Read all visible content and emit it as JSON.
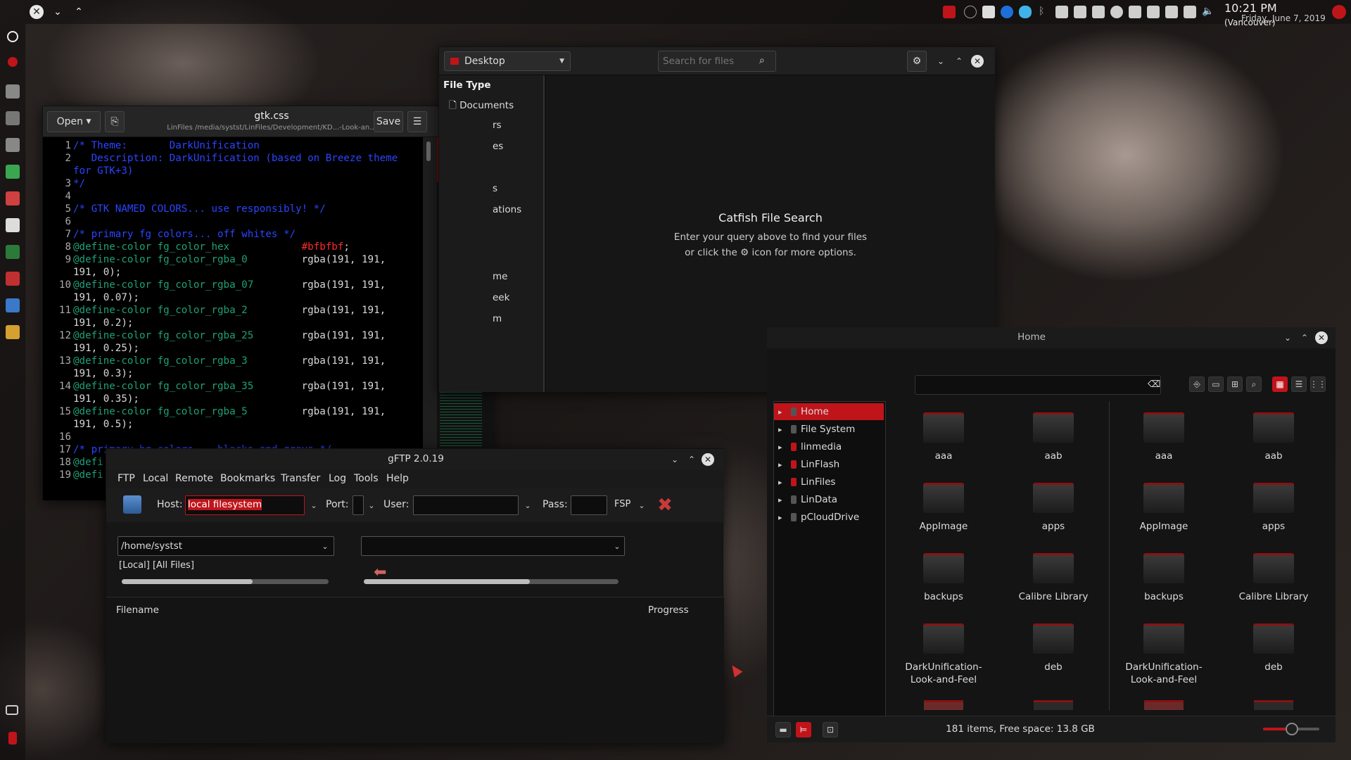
{
  "topbar": {
    "clock_time": "10:21 PM",
    "clock_tz": "(Vancouver)",
    "clock_date": "Friday, June 7, 2019"
  },
  "gedit": {
    "open_label": "Open",
    "title": "gtk.css",
    "path": "LinFiles /media/systst/LinFiles/Development/KD...-Look-an...",
    "save_label": "Save",
    "lines": [
      {
        "n": "1",
        "segs": [
          [
            "cm",
            "/* Theme:       DarkUnification"
          ]
        ]
      },
      {
        "n": "2",
        "segs": [
          [
            "cm",
            "   Description: DarkUnification (based on Breeze theme"
          ]
        ]
      },
      {
        "n": "",
        "segs": [
          [
            "cm",
            "for GTK+3)"
          ]
        ]
      },
      {
        "n": "3",
        "segs": [
          [
            "cm",
            "*/"
          ]
        ]
      },
      {
        "n": "4",
        "segs": []
      },
      {
        "n": "5",
        "segs": [
          [
            "cm",
            "/* GTK NAMED COLORS... use responsibly! */"
          ]
        ]
      },
      {
        "n": "6",
        "segs": []
      },
      {
        "n": "7",
        "segs": [
          [
            "cm",
            "/* primary fg colors... off whites */"
          ]
        ]
      },
      {
        "n": "8",
        "segs": [
          [
            "df",
            "@define-color fg_color_hex            "
          ],
          [
            "hx",
            "#bfbfbf"
          ],
          [
            "wh",
            ";"
          ]
        ]
      },
      {
        "n": "9",
        "segs": [
          [
            "df",
            "@define-color fg_color_rgba_0         "
          ],
          [
            "wh",
            "rgba(191, 191,"
          ]
        ]
      },
      {
        "n": "",
        "segs": [
          [
            "wh",
            "191, 0);"
          ]
        ]
      },
      {
        "n": "10",
        "segs": [
          [
            "df",
            "@define-color fg_color_rgba_07        "
          ],
          [
            "wh",
            "rgba(191, 191,"
          ]
        ]
      },
      {
        "n": "",
        "segs": [
          [
            "wh",
            "191, 0.07);"
          ]
        ]
      },
      {
        "n": "11",
        "segs": [
          [
            "df",
            "@define-color fg_color_rgba_2         "
          ],
          [
            "wh",
            "rgba(191, 191,"
          ]
        ]
      },
      {
        "n": "",
        "segs": [
          [
            "wh",
            "191, 0.2);"
          ]
        ]
      },
      {
        "n": "12",
        "segs": [
          [
            "df",
            "@define-color fg_color_rgba_25        "
          ],
          [
            "wh",
            "rgba(191, 191,"
          ]
        ]
      },
      {
        "n": "",
        "segs": [
          [
            "wh",
            "191, 0.25);"
          ]
        ]
      },
      {
        "n": "13",
        "segs": [
          [
            "df",
            "@define-color fg_color_rgba_3         "
          ],
          [
            "wh",
            "rgba(191, 191,"
          ]
        ]
      },
      {
        "n": "",
        "segs": [
          [
            "wh",
            "191, 0.3);"
          ]
        ]
      },
      {
        "n": "14",
        "segs": [
          [
            "df",
            "@define-color fg_color_rgba_35        "
          ],
          [
            "wh",
            "rgba(191, 191,"
          ]
        ]
      },
      {
        "n": "",
        "segs": [
          [
            "wh",
            "191, 0.35);"
          ]
        ]
      },
      {
        "n": "15",
        "segs": [
          [
            "df",
            "@define-color fg_color_rgba_5         "
          ],
          [
            "wh",
            "rgba(191, 191,"
          ]
        ]
      },
      {
        "n": "",
        "segs": [
          [
            "wh",
            "191, 0.5);"
          ]
        ]
      },
      {
        "n": "16",
        "segs": []
      },
      {
        "n": "17",
        "segs": [
          [
            "cm",
            "/* primary bg colors... blacks and greys */"
          ]
        ]
      },
      {
        "n": "18",
        "segs": [
          [
            "df",
            "@defi"
          ]
        ]
      },
      {
        "n": "19",
        "segs": [
          [
            "df",
            "@defi"
          ]
        ]
      }
    ]
  },
  "catfish": {
    "location": "Desktop",
    "search_placeholder": "Search for files",
    "file_type_heading": "File Type",
    "side_items": [
      "Documents",
      "rs",
      "es",
      "s",
      "ations",
      "me",
      "eek",
      "m"
    ],
    "heading": "Catfish File Search",
    "hint_line1": "Enter your query above to find your files",
    "hint_line2a": "or click the",
    "hint_line2b": "icon for more options."
  },
  "file_manager": {
    "title": "Home",
    "tree": [
      "Home",
      "File System",
      "linmedia",
      "LinFlash",
      "LinFiles",
      "LinData",
      "pCloudDrive"
    ],
    "folders_left": [
      "aaa",
      "aab",
      "AppImage",
      "apps",
      "backups",
      "Calibre Library",
      "DarkUnification-Look-and-Feel",
      "deb"
    ],
    "folders_right": [
      "aaa",
      "aab",
      "AppImage",
      "apps",
      "backups",
      "Calibre Library",
      "DarkUnification-Look-and-Feel",
      "deb"
    ],
    "status": "181 items, Free space: 13.8 GB"
  },
  "gftp": {
    "title": "gFTP 2.0.19",
    "menu": [
      "FTP",
      "Local",
      "Remote",
      "Bookmarks",
      "Transfer",
      "Log",
      "Tools",
      "Help"
    ],
    "host_label": "Host:",
    "host_value": "local filesystem",
    "port_label": "Port:",
    "user_label": "User:",
    "pass_label": "Pass:",
    "protocol": "FSP",
    "local_path": "/home/systst",
    "local_filter": "[Local] [All Files]",
    "col_filename": "Filename",
    "col_progress": "Progress"
  },
  "colors": {
    "accent": "#c0141b",
    "comment": "#2a45ff",
    "define": "#1fa07a",
    "hex": "#ff2b2b"
  }
}
